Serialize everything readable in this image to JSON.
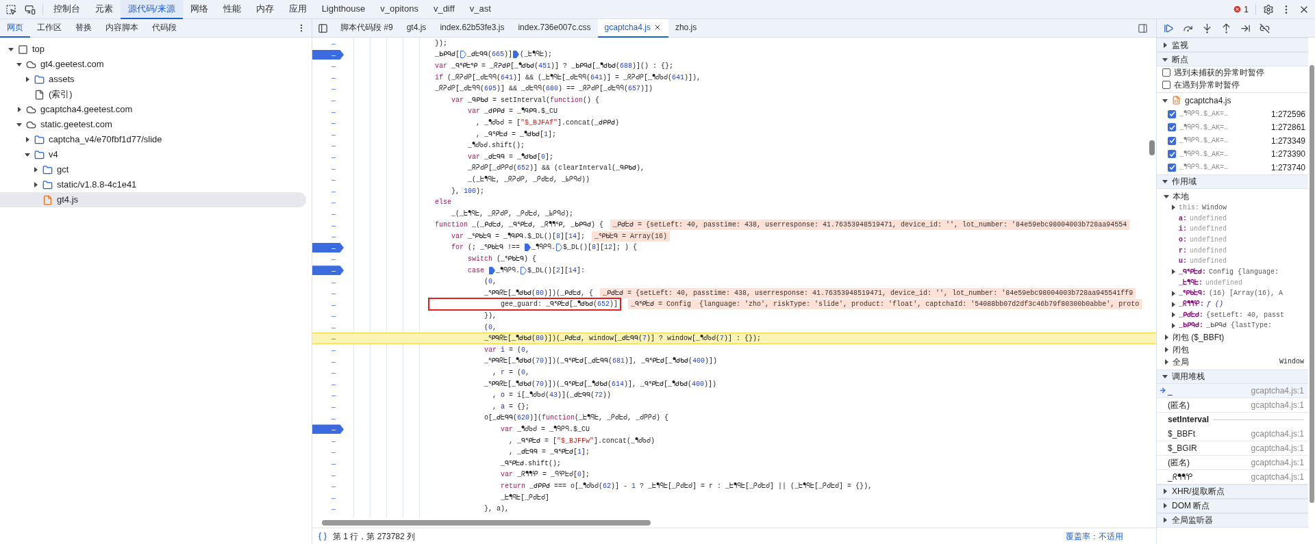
{
  "main_tabs": [
    {
      "label": "控制台",
      "selected": false
    },
    {
      "label": "元素",
      "selected": false
    },
    {
      "label": "源代码/来源",
      "selected": true
    },
    {
      "label": "网络",
      "selected": false
    },
    {
      "label": "性能",
      "selected": false
    },
    {
      "label": "内存",
      "selected": false
    },
    {
      "label": "应用",
      "selected": false
    },
    {
      "label": "Lighthouse",
      "selected": false
    },
    {
      "label": "v_opitons",
      "selected": false
    },
    {
      "label": "v_diff",
      "selected": false
    },
    {
      "label": "v_ast",
      "selected": false
    }
  ],
  "error_count": "1",
  "navigator_tabs": [
    {
      "label": "网页",
      "selected": true
    },
    {
      "label": "工作区",
      "selected": false
    },
    {
      "label": "替换",
      "selected": false
    },
    {
      "label": "内容脚本",
      "selected": false
    },
    {
      "label": "代码段",
      "selected": false
    }
  ],
  "tree": [
    {
      "label": "top",
      "kind": "frame",
      "expanded": true,
      "selected": false,
      "children": [
        {
          "label": "gt4.geetest.com",
          "kind": "domain",
          "expanded": true,
          "selected": false,
          "children": [
            {
              "label": "assets",
              "kind": "folder",
              "expanded": false,
              "selected": false
            },
            {
              "label": "(索引)",
              "kind": "file",
              "selected": false
            }
          ]
        },
        {
          "label": "gcaptcha4.geetest.com",
          "kind": "domain",
          "expanded": false,
          "selected": false
        },
        {
          "label": "static.geetest.com",
          "kind": "domain",
          "expanded": true,
          "selected": false,
          "children": [
            {
              "label": "captcha_v4/e70fbf1d77/slide",
              "kind": "folder",
              "expanded": false,
              "selected": false
            },
            {
              "label": "v4",
              "kind": "folder",
              "expanded": true,
              "selected": false,
              "children": [
                {
                  "label": "gct",
                  "kind": "folder",
                  "expanded": false,
                  "selected": false
                },
                {
                  "label": "static/v1.8.8-4c1e41",
                  "kind": "folder",
                  "expanded": false,
                  "selected": false
                },
                {
                  "label": "gt4.js",
                  "kind": "script",
                  "selected": true
                }
              ]
            }
          ]
        }
      ]
    }
  ],
  "editor_tabs": [
    {
      "label": "脚本代码段 #9",
      "selected": false,
      "closable": false
    },
    {
      "label": "gt4.js",
      "selected": false,
      "closable": false
    },
    {
      "label": "index.62b53fe3.js",
      "selected": false,
      "closable": false
    },
    {
      "label": "index.736e007c.css",
      "selected": false,
      "closable": false
    },
    {
      "label": "gcaptcha4.js",
      "selected": true,
      "closable": true
    },
    {
      "label": "zho.js",
      "selected": false,
      "closable": false
    }
  ],
  "code_lines": [
    {
      "number": "–",
      "breakpoint": false,
      "paused": false,
      "boxed": false,
      "segments": [
        {
          "t": "});"
        }
      ]
    },
    {
      "number": "–",
      "breakpoint": true,
      "paused": false,
      "boxed": false,
      "segments": [
        {
          "t": "_ᖯᑭᑫᑯ["
        },
        {
          "kind": "marker",
          "on": false
        },
        {
          "t": "_ᑯᖶᑫᑫ("
        },
        {
          "kind": "num",
          "t": "665"
        },
        {
          "t": ")]"
        },
        {
          "kind": "marker",
          "on": true
        },
        {
          "t": "(_ᖶᖳᑫᖶ);"
        }
      ]
    },
    {
      "number": "–",
      "breakpoint": false,
      "paused": false,
      "boxed": false,
      "segments": [
        {
          "kind": "kw",
          "t": "var"
        },
        {
          "t": " _ᑫᕿᖶᕿ = _ᖇᕈᑯᑭ[_ᖳᑯᑲᑯ("
        },
        {
          "kind": "num",
          "t": "451"
        },
        {
          "t": ")] ? _ᖯᑭᑫᑯ[_ᖳᑯᑲᑯ("
        },
        {
          "kind": "num",
          "t": "688"
        },
        {
          "t": ")]() : {};"
        }
      ]
    },
    {
      "number": "–",
      "breakpoint": false,
      "paused": false,
      "boxed": false,
      "segments": [
        {
          "kind": "kw",
          "t": "if"
        },
        {
          "t": " (_ᖇᕈᑯᑭ[_ᑯᖶᑫᑫ("
        },
        {
          "kind": "num",
          "t": "641"
        },
        {
          "t": ")] && (_ᖶᖳᑫᖶ[_ᑯᖶᑫᑫ("
        },
        {
          "kind": "num",
          "t": "641"
        },
        {
          "t": ")] = _ᖇᕈᑯᑭ[_ᖳᑯᑲᑯ("
        },
        {
          "kind": "num",
          "t": "641"
        },
        {
          "t": ")]),"
        }
      ]
    },
    {
      "number": "–",
      "breakpoint": false,
      "paused": false,
      "boxed": false,
      "segments": [
        {
          "t": "_ᖇᕈᑯᑭ[_ᑯᖶᑫᑫ("
        },
        {
          "kind": "num",
          "t": "695"
        },
        {
          "t": ")] && _ᑯᖶᑫᑫ("
        },
        {
          "kind": "num",
          "t": "680"
        },
        {
          "t": ") == _ᖇᕈᑯᑭ[_ᑯᖶᑫᑫ("
        },
        {
          "kind": "num",
          "t": "657"
        },
        {
          "t": ")])"
        }
      ]
    },
    {
      "number": "–",
      "breakpoint": false,
      "paused": false,
      "boxed": false,
      "segments": [
        {
          "kind": "kw",
          "t": "    var"
        },
        {
          "t": " _ᑫᑭᑲᑯ = setInterval("
        },
        {
          "kind": "kw",
          "t": "function"
        },
        {
          "t": "() {"
        }
      ]
    },
    {
      "number": "–",
      "breakpoint": false,
      "paused": false,
      "boxed": false,
      "segments": [
        {
          "kind": "kw",
          "t": "        var"
        },
        {
          "t": " _ᑯᑭᑭᑯ = _ᖳᑫᑭᑫ.$_CU"
        }
      ]
    },
    {
      "number": "–",
      "breakpoint": false,
      "paused": false,
      "boxed": false,
      "segments": [
        {
          "t": "          , _ᖳᑯᑲᑯ = ["
        },
        {
          "kind": "str",
          "t": "\"$_BJFAf\""
        },
        {
          "t": "].concat(_ᑯᑭᑭᑯ)"
        }
      ]
    },
    {
      "number": "–",
      "breakpoint": false,
      "paused": false,
      "boxed": false,
      "segments": [
        {
          "t": "          , _ᑫᕿᖶᑯ = _ᖳᑯᑲᑯ["
        },
        {
          "kind": "num",
          "t": "1"
        },
        {
          "t": "];"
        }
      ]
    },
    {
      "number": "–",
      "breakpoint": false,
      "paused": false,
      "boxed": false,
      "segments": [
        {
          "t": "        _ᖳᑯᑲᑯ.shift();"
        }
      ]
    },
    {
      "number": "–",
      "breakpoint": false,
      "paused": false,
      "boxed": false,
      "segments": [
        {
          "kind": "kw",
          "t": "        var"
        },
        {
          "t": " _ᑯᖶᑫᑫ = _ᖳᑯᑲᑯ["
        },
        {
          "kind": "num",
          "t": "0"
        },
        {
          "t": "];"
        }
      ]
    },
    {
      "number": "–",
      "breakpoint": false,
      "paused": false,
      "boxed": false,
      "segments": [
        {
          "t": "        _ᖇᕈᑯᑭ[_ᑯᑭᑭᑯ("
        },
        {
          "kind": "num",
          "t": "652"
        },
        {
          "t": ")] && (clearInterval(_ᑫᑭᑲᑯ),"
        }
      ]
    },
    {
      "number": "–",
      "breakpoint": false,
      "paused": false,
      "boxed": false,
      "segments": [
        {
          "t": "        _(_ᖶᖳᑫᖶ, _ᖇᕈᑯᑭ, _ᑭᑯᖶᑯ, _ᖯᑭᑫᑯ))"
        }
      ]
    },
    {
      "number": "–",
      "breakpoint": false,
      "paused": false,
      "boxed": false,
      "segments": [
        {
          "t": "    }, "
        },
        {
          "kind": "num",
          "t": "100"
        },
        {
          "t": ");"
        }
      ]
    },
    {
      "number": "–",
      "breakpoint": false,
      "paused": false,
      "boxed": false,
      "segments": [
        {
          "kind": "kw",
          "t": "else"
        }
      ]
    },
    {
      "number": "–",
      "breakpoint": false,
      "paused": false,
      "boxed": false,
      "segments": [
        {
          "t": "    _(_ᖶᖳᑫᖶ, _ᖇᕈᑯᑭ, _ᑭᑯᖶᑯ, _ᖯᑭᑫᑯ);"
        }
      ]
    },
    {
      "number": "–",
      "breakpoint": false,
      "paused": false,
      "boxed": false,
      "segments": [
        {
          "kind": "kw",
          "t": "function"
        },
        {
          "t": " _(_ᑭᑯᖶᑯ, _ᑫᕿᖶᑯ, _ᖇᖳᖳᕿ, _ᖯᑭᑫᑯ) {"
        }
      ],
      "inline_value": "_ᑭᑯᖶᑯ = {setLeft: 40, passtime: 438, userresponse: 41.76353948519471, device_id: '', lot_number: '84e59ebc98004003b728aa94554"
    },
    {
      "number": "–",
      "breakpoint": false,
      "paused": false,
      "boxed": false,
      "segments": [
        {
          "kind": "kw",
          "t": "    var"
        },
        {
          "t": " _ᕿᑲᖶᑫ = _ᖳᑫᑭᑫ.$_DL()["
        },
        {
          "kind": "num",
          "t": "8"
        },
        {
          "t": "]["
        },
        {
          "kind": "num",
          "t": "14"
        },
        {
          "t": "];"
        }
      ],
      "inline_value": "_ᕿᑲᖶᑫ = Array(16)"
    },
    {
      "number": "–",
      "breakpoint": true,
      "paused": false,
      "boxed": false,
      "segments": [
        {
          "kind": "kw",
          "t": "    for"
        },
        {
          "t": " (; _ᕿᑲᖶᑫ !== "
        },
        {
          "kind": "marker",
          "on": true
        },
        {
          "t": "_ᖳᑫᑭᑫ."
        },
        {
          "kind": "marker",
          "on": false
        },
        {
          "t": "$_DL()["
        },
        {
          "kind": "num",
          "t": "8"
        },
        {
          "t": "]["
        },
        {
          "kind": "num",
          "t": "12"
        },
        {
          "t": "]; ) {"
        }
      ]
    },
    {
      "number": "–",
      "breakpoint": false,
      "paused": false,
      "boxed": false,
      "segments": [
        {
          "kind": "kw",
          "t": "        switch"
        },
        {
          "t": " (_ᕿᑲᖶᑫ) {"
        }
      ]
    },
    {
      "number": "–",
      "breakpoint": true,
      "paused": false,
      "boxed": false,
      "segments": [
        {
          "kind": "kw",
          "t": "        case "
        },
        {
          "kind": "marker",
          "on": true
        },
        {
          "t": "_ᖳᑫᑭᑫ."
        },
        {
          "kind": "marker",
          "on": false
        },
        {
          "t": "$_DL()["
        },
        {
          "kind": "num",
          "t": "2"
        },
        {
          "t": "]["
        },
        {
          "kind": "num",
          "t": "14"
        },
        {
          "t": "]:"
        }
      ]
    },
    {
      "number": "–",
      "breakpoint": false,
      "paused": false,
      "boxed": false,
      "segments": [
        {
          "t": "            ("
        },
        {
          "kind": "num",
          "t": "0"
        },
        {
          "t": ","
        }
      ]
    },
    {
      "number": "–",
      "breakpoint": false,
      "paused": false,
      "boxed": false,
      "segments": [
        {
          "t": "            _ᕿᑫᖇᖶ[_ᖳᑯᑲᑯ("
        },
        {
          "kind": "num",
          "t": "80"
        },
        {
          "t": ")])(_ᑭᑯᖶᑯ, {"
        }
      ],
      "inline_value": "_ᑭᑯᖶᑯ = {setLeft: 40, passtime: 438, userresponse: 41.76353948519471, device_id: '', lot_number: '84e59ebc98004003b728aa945541ff9"
    },
    {
      "number": "–",
      "breakpoint": false,
      "paused": false,
      "boxed": true,
      "segments": [
        {
          "t": "                gee_guard: _ᑫᕿᖶᑯ[_ᖳᑯᑲᑯ("
        },
        {
          "kind": "num",
          "t": "652"
        },
        {
          "t": ")]"
        }
      ],
      "inline_value": "_ᑫᕿᖶᑯ = Config  {language: 'zho', riskType: 'slide', product: 'float', captchaId: '54088bb07d2df3c46b79f80300b0abbe', proto"
    },
    {
      "number": "–",
      "breakpoint": false,
      "paused": false,
      "boxed": false,
      "segments": [
        {
          "t": "            }),"
        }
      ]
    },
    {
      "number": "–",
      "breakpoint": false,
      "paused": false,
      "boxed": false,
      "segments": [
        {
          "t": "            ("
        },
        {
          "kind": "num",
          "t": "0"
        },
        {
          "t": ","
        }
      ]
    },
    {
      "number": "–",
      "breakpoint": false,
      "paused": true,
      "boxed": false,
      "segments": [
        {
          "t": "            _ᕿᑫᖇᖶ[_ᖳᑯᑲᑯ("
        },
        {
          "kind": "num",
          "t": "80"
        },
        {
          "t": ")])(_ᑭᑯᖶᑯ, window[_ᑯᖶᑫᑫ("
        },
        {
          "kind": "num",
          "t": "7"
        },
        {
          "t": ")] ? window[_ᖳᑯᑲᑯ("
        },
        {
          "kind": "num",
          "t": "7"
        },
        {
          "t": ")] : {});"
        }
      ]
    },
    {
      "number": "–",
      "breakpoint": false,
      "paused": false,
      "boxed": false,
      "segments": [
        {
          "kind": "kw",
          "t": "            var "
        },
        {
          "kind": "def",
          "t": "i"
        },
        {
          "t": " = ("
        },
        {
          "kind": "num",
          "t": "0"
        },
        {
          "t": ","
        }
      ]
    },
    {
      "number": "–",
      "breakpoint": false,
      "paused": false,
      "boxed": false,
      "segments": [
        {
          "t": "            _ᕿᑫᖇᖶ[_ᖳᑯᑲᑯ("
        },
        {
          "kind": "num",
          "t": "70"
        },
        {
          "t": ")])(_ᑫᕿᖶᑯ[_ᑯᖶᑫᑫ("
        },
        {
          "kind": "num",
          "t": "681"
        },
        {
          "t": ")], _ᑫᕿᖶᑯ[_ᖳᑯᑲᑯ("
        },
        {
          "kind": "num",
          "t": "400"
        },
        {
          "t": ")])"
        }
      ]
    },
    {
      "number": "–",
      "breakpoint": false,
      "paused": false,
      "boxed": false,
      "segments": [
        {
          "t": "              , "
        },
        {
          "kind": "def",
          "t": "r"
        },
        {
          "t": " = ("
        },
        {
          "kind": "num",
          "t": "0"
        },
        {
          "t": ","
        }
      ]
    },
    {
      "number": "–",
      "breakpoint": false,
      "paused": false,
      "boxed": false,
      "segments": [
        {
          "t": "            _ᕿᑫᖇᖶ[_ᖳᑯᑲᑯ("
        },
        {
          "kind": "num",
          "t": "70"
        },
        {
          "t": ")])(_ᑫᕿᖶᑯ[_ᖳᑯᑲᑯ("
        },
        {
          "kind": "num",
          "t": "614"
        },
        {
          "t": ")], _ᑫᕿᖶᑯ[_ᖳᑯᑲᑯ("
        },
        {
          "kind": "num",
          "t": "400"
        },
        {
          "t": ")])"
        }
      ]
    },
    {
      "number": "–",
      "breakpoint": false,
      "paused": false,
      "boxed": false,
      "segments": [
        {
          "t": "              , "
        },
        {
          "kind": "def",
          "t": "o"
        },
        {
          "t": " = i[_ᖳᑯᑲᑯ("
        },
        {
          "kind": "num",
          "t": "43"
        },
        {
          "t": ")](_ᑯᖶᑫᑫ("
        },
        {
          "kind": "num",
          "t": "72"
        },
        {
          "t": "))"
        }
      ]
    },
    {
      "number": "–",
      "breakpoint": false,
      "paused": false,
      "boxed": false,
      "segments": [
        {
          "t": "              , "
        },
        {
          "kind": "def",
          "t": "a"
        },
        {
          "t": " = {};"
        }
      ]
    },
    {
      "number": "–",
      "breakpoint": false,
      "paused": false,
      "boxed": false,
      "segments": [
        {
          "t": "            o[_ᑯᖶᑫᑫ("
        },
        {
          "kind": "num",
          "t": "620"
        },
        {
          "t": ")]("
        },
        {
          "kind": "kw",
          "t": "function"
        },
        {
          "t": "(_ᖶᖳᑫᖶ, _ᑭᑯᖶᑯ, _ᑯᑭᑭᑯ) {"
        }
      ]
    },
    {
      "number": "–",
      "breakpoint": true,
      "paused": false,
      "boxed": false,
      "segments": [
        {
          "kind": "kw",
          "t": "                var"
        },
        {
          "t": " _ᖳᑯᑲᑯ = _ᖳᑫᑭᑫ.$_CU"
        }
      ]
    },
    {
      "number": "–",
      "breakpoint": false,
      "paused": false,
      "boxed": false,
      "segments": [
        {
          "t": "                  , _ᑫᕿᖶᑯ = ["
        },
        {
          "kind": "str",
          "t": "\"$_BJFFw\""
        },
        {
          "t": "].concat(_ᖳᑯᑲᑯ)"
        }
      ]
    },
    {
      "number": "–",
      "breakpoint": false,
      "paused": false,
      "boxed": false,
      "segments": [
        {
          "t": "                  , _ᑯᖶᑫᑫ = _ᑫᕿᖶᑯ["
        },
        {
          "kind": "num",
          "t": "1"
        },
        {
          "t": "];"
        }
      ]
    },
    {
      "number": "–",
      "breakpoint": false,
      "paused": false,
      "boxed": false,
      "segments": [
        {
          "t": "                _ᑫᕿᖶᑯ.shift();"
        }
      ]
    },
    {
      "number": "–",
      "breakpoint": false,
      "paused": false,
      "boxed": false,
      "segments": [
        {
          "kind": "kw",
          "t": "                var"
        },
        {
          "t": " _ᖇᖳᖳᕿ = _ᑫᕿᖶᑯ["
        },
        {
          "kind": "num",
          "t": "0"
        },
        {
          "t": "];"
        }
      ]
    },
    {
      "number": "–",
      "breakpoint": false,
      "paused": false,
      "boxed": false,
      "segments": [
        {
          "kind": "kw",
          "t": "                return"
        },
        {
          "t": " _ᑯᑭᑭᑯ === o[_ᖳᑯᑲᑯ("
        },
        {
          "kind": "num",
          "t": "62"
        },
        {
          "t": ")] - "
        },
        {
          "kind": "num",
          "t": "1"
        },
        {
          "t": " ? _ᖶᖳᑫᖶ[_ᑭᑯᖶᑯ] = r : _ᖶᖳᑫᖶ[_ᑭᑯᖶᑯ] || (_ᖶᖳᑫᖶ[_ᑭᑯᖶᑯ] = {}),"
        }
      ]
    },
    {
      "number": "–",
      "breakpoint": false,
      "paused": false,
      "boxed": false,
      "segments": [
        {
          "t": "                _ᖶᖳᑫᖶ[_ᑭᑯᖶᑯ]"
        }
      ]
    },
    {
      "number": "–",
      "breakpoint": false,
      "paused": false,
      "boxed": false,
      "segments": [
        {
          "t": "            }, a),"
        }
      ]
    }
  ],
  "status_bar": {
    "position": "第 1 行，第 273782 列",
    "coverage": "覆盖率：不适用"
  },
  "debugger": {
    "sections": [
      {
        "title": "监视",
        "expanded": false
      },
      {
        "title": "断点",
        "expanded": true,
        "kind": "breakpoints"
      },
      {
        "title": "作用域",
        "expanded": true,
        "kind": "scope"
      },
      {
        "title": "调用堆栈",
        "expanded": true,
        "kind": "stack"
      },
      {
        "title": "XHR/提取断点",
        "expanded": false
      },
      {
        "title": "DOM 断点",
        "expanded": false
      },
      {
        "title": "全局监听器",
        "expanded": false
      }
    ],
    "exception_options": [
      {
        "label": "遇到未捕获的异常时暂停",
        "checked": false
      },
      {
        "label": "在遇到异常时暂停",
        "checked": false
      }
    ],
    "breakpoint_file": "gcaptcha4.js",
    "breakpoints": [
      {
        "code": "_ᖳᑫᑭᑫ.$_AK=…",
        "location": "1:272596",
        "checked": true
      },
      {
        "code": "_ᖳᑫᑭᑫ.$_AK=…",
        "location": "1:272861",
        "checked": true
      },
      {
        "code": "_ᖳᑫᑭᑫ.$_AK=…",
        "location": "1:273349",
        "checked": true
      },
      {
        "code": "_ᖳᑫᑭᑫ.$_AK=…",
        "location": "1:273390",
        "checked": true
      },
      {
        "code": "_ᖳᑫᑭᑫ.$_AK=…",
        "location": "1:273740",
        "checked": true
      }
    ],
    "scopes": [
      {
        "title": "本地",
        "expanded": true,
        "variables": [
          {
            "name": "this:",
            "value": "Window",
            "kind": "object",
            "expandable": true
          },
          {
            "name": "a:",
            "value": "undefined",
            "kind": "undefined",
            "expandable": false
          },
          {
            "name": "i:",
            "value": "undefined",
            "kind": "undefined",
            "expandable": false
          },
          {
            "name": "o:",
            "value": "undefined",
            "kind": "undefined",
            "expandable": false
          },
          {
            "name": "r:",
            "value": "undefined",
            "kind": "undefined",
            "expandable": false
          },
          {
            "name": "u:",
            "value": "undefined",
            "kind": "undefined",
            "expandable": false
          },
          {
            "name": "_ᑫᕿᖶᑯ:",
            "value": "Config  {language:",
            "kind": "object",
            "expandable": true
          },
          {
            "name": "_ᖶᖳᑫᖶ:",
            "value": "undefined",
            "kind": "undefined",
            "expandable": false
          },
          {
            "name": "_ᕿᑲᖶᑫ:",
            "value": "(16)  [Array(16), A",
            "kind": "object",
            "expandable": true
          },
          {
            "name": "_ᖇᖳᖳᕿ:",
            "value": "ƒ ()",
            "kind": "function",
            "expandable": true
          },
          {
            "name": "_ᑭᑯᖶᑯ:",
            "value": "{setLeft: 40, passt",
            "kind": "object",
            "expandable": true
          },
          {
            "name": "_ᖯᑭᑫᑯ:",
            "value": "_ᖯᑭᑫᑯ  {lastType:",
            "kind": "object",
            "expandable": true
          }
        ]
      },
      {
        "title": "闭包 ($_BBFt)",
        "expanded": false
      },
      {
        "title": "闭包",
        "expanded": false
      },
      {
        "title": "全局",
        "expanded": false,
        "value": "Window"
      }
    ],
    "call_stack": [
      {
        "kind": "frame",
        "name": "_",
        "location": "gcaptcha4.js:1",
        "selected": true
      },
      {
        "kind": "frame",
        "name": "(匿名)",
        "location": "gcaptcha4.js:1",
        "selected": false
      },
      {
        "kind": "async",
        "name": "setInterval"
      },
      {
        "kind": "frame",
        "name": "$_BBFt",
        "location": "gcaptcha4.js:1",
        "selected": false
      },
      {
        "kind": "frame",
        "name": "$_BGIR",
        "location": "gcaptcha4.js:1",
        "selected": false
      },
      {
        "kind": "frame",
        "name": "(匿名)",
        "location": "gcaptcha4.js:1",
        "selected": false
      },
      {
        "kind": "frame",
        "name": "_ᖇᖳᖳᕿ",
        "location": "gcaptcha4.js:1",
        "selected": false
      }
    ]
  }
}
